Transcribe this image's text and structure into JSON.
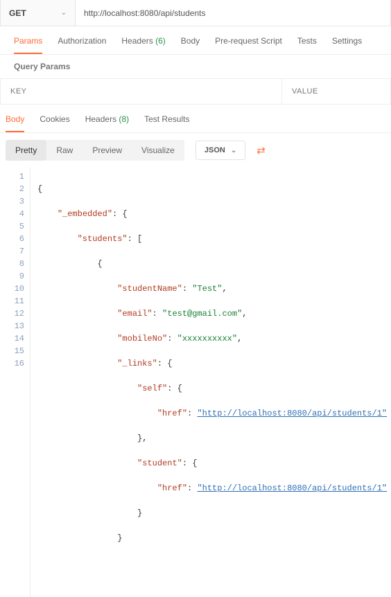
{
  "request": {
    "method": "GET",
    "url": "http://localhost:8080/api/students"
  },
  "req_tabs": [
    "Params",
    "Authorization",
    "Headers",
    "Body",
    "Pre-request Script",
    "Tests",
    "Settings"
  ],
  "req_tab_active": "Params",
  "headers_badge": "(6)",
  "query_params": {
    "title": "Query Params",
    "key_header": "KEY",
    "value_header": "VALUE"
  },
  "res_tabs": [
    "Body",
    "Cookies",
    "Headers",
    "Test Results"
  ],
  "res_tab_active": "Body",
  "res_headers_badge": "(8)",
  "view_modes": [
    "Pretty",
    "Raw",
    "Preview",
    "Visualize"
  ],
  "view_mode_active": "Pretty",
  "format_selector": "JSON",
  "line_numbers": [
    "1",
    "2",
    "3",
    "4",
    "5",
    "6",
    "7",
    "8",
    "9",
    "10",
    "11",
    "12",
    "13",
    "14",
    "15",
    "16"
  ],
  "code": {
    "k_embedded": "\"_embedded\"",
    "k_students": "\"students\"",
    "k_studentName": "\"studentName\"",
    "v_studentName": "\"Test\"",
    "k_email": "\"email\"",
    "v_email": "\"test@gmail.com\"",
    "k_mobileNo": "\"mobileNo\"",
    "v_mobileNo": "\"xxxxxxxxxx\"",
    "k_links": "\"_links\"",
    "k_self": "\"self\"",
    "k_href": "\"href\"",
    "v_href1": "\"http://localhost:8080/api/students/1\"",
    "k_student": "\"student\"",
    "v_href2": "\"http://localhost:8080/api/students/1\""
  },
  "chart_data": {
    "type": "json_response",
    "value": {
      "_embedded": {
        "students": [
          {
            "studentName": "Test",
            "email": "test@gmail.com",
            "mobileNo": "xxxxxxxxxx",
            "_links": {
              "self": {
                "href": "http://localhost:8080/api/students/1"
              },
              "student": {
                "href": "http://localhost:8080/api/students/1"
              }
            }
          }
        ]
      }
    }
  }
}
